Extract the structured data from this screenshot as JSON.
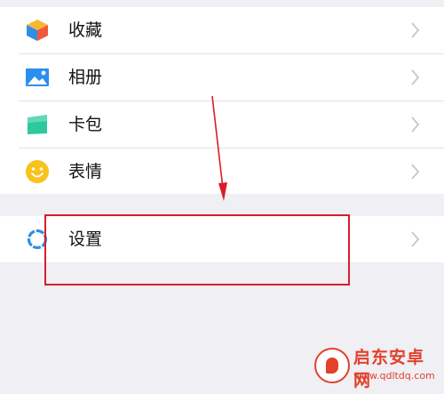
{
  "menu": {
    "group1": [
      {
        "key": "favorites",
        "label": "收藏",
        "icon": "cube-icon"
      },
      {
        "key": "album",
        "label": "相册",
        "icon": "picture-icon"
      },
      {
        "key": "wallet",
        "label": "卡包",
        "icon": "card-icon"
      },
      {
        "key": "stickers",
        "label": "表情",
        "icon": "smiley-icon"
      }
    ],
    "group2": [
      {
        "key": "settings",
        "label": "设置",
        "icon": "gear-icon"
      }
    ],
    "chevron_icon": "chevron-right-icon"
  },
  "annotation": {
    "color": "#d81e2a"
  },
  "watermark": {
    "title": "启东安卓网",
    "url": "www.qdltdq.com",
    "color": "#e2412c"
  },
  "colors": {
    "background": "#efeff4",
    "cube_yellow": "#f7b731",
    "cube_blue": "#2f8ee8",
    "cube_red": "#ef5a3c",
    "album_blue": "#2b8ff0",
    "card_green": "#2ec8a0",
    "smiley_yellow": "#f9c21c",
    "gear_blue": "#2f8ee8"
  }
}
